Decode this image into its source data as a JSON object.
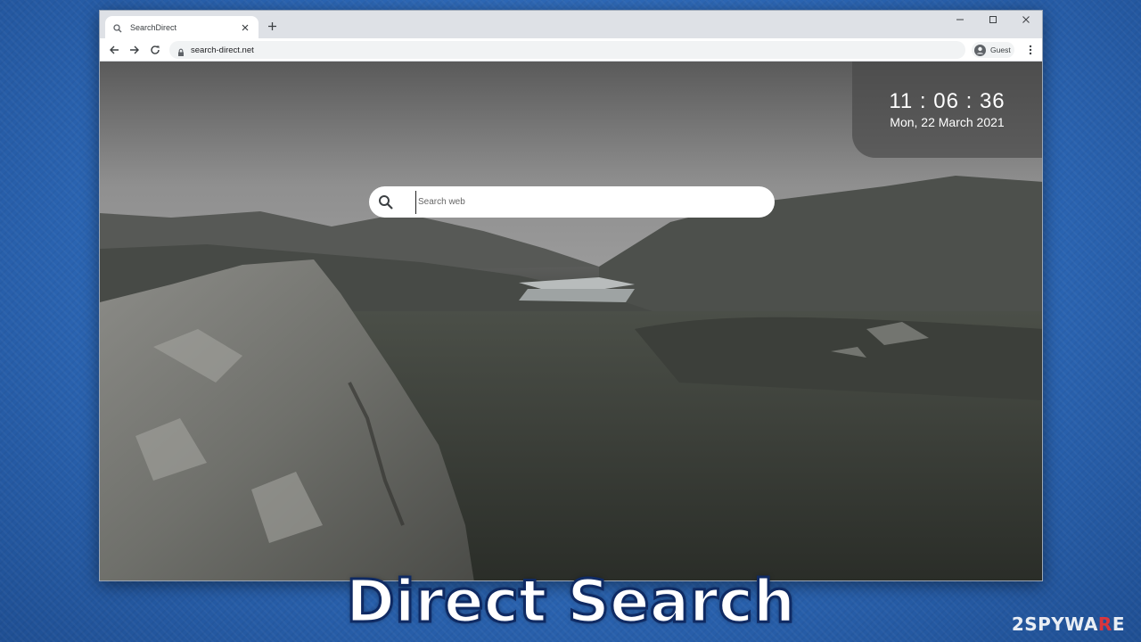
{
  "browser": {
    "tab": {
      "title": "SearchDirect"
    },
    "address": {
      "url": "search-direct.net"
    },
    "profile": {
      "label": "Guest"
    }
  },
  "page": {
    "clock": {
      "time": "11 : 06 : 36",
      "date": "Mon, 22 March 2021"
    },
    "search": {
      "placeholder": "Search web"
    }
  },
  "caption": {
    "text": "Direct Search"
  },
  "watermark": {
    "prefix": "2",
    "brand_start": "SPYWA",
    "brand_accent": "R",
    "brand_end": "E"
  },
  "colors": {
    "desktop": "#2c67b6",
    "caption_outline": "#0f2a63",
    "tabstrip": "#dee1e6"
  },
  "icons": {
    "tab": "search-icon",
    "close": "close-icon",
    "new_tab": "plus-icon",
    "back": "arrow-left-icon",
    "forward": "arrow-right-icon",
    "reload": "reload-icon",
    "lock": "lock-icon",
    "avatar": "person-icon",
    "menu": "kebab-menu-icon"
  }
}
